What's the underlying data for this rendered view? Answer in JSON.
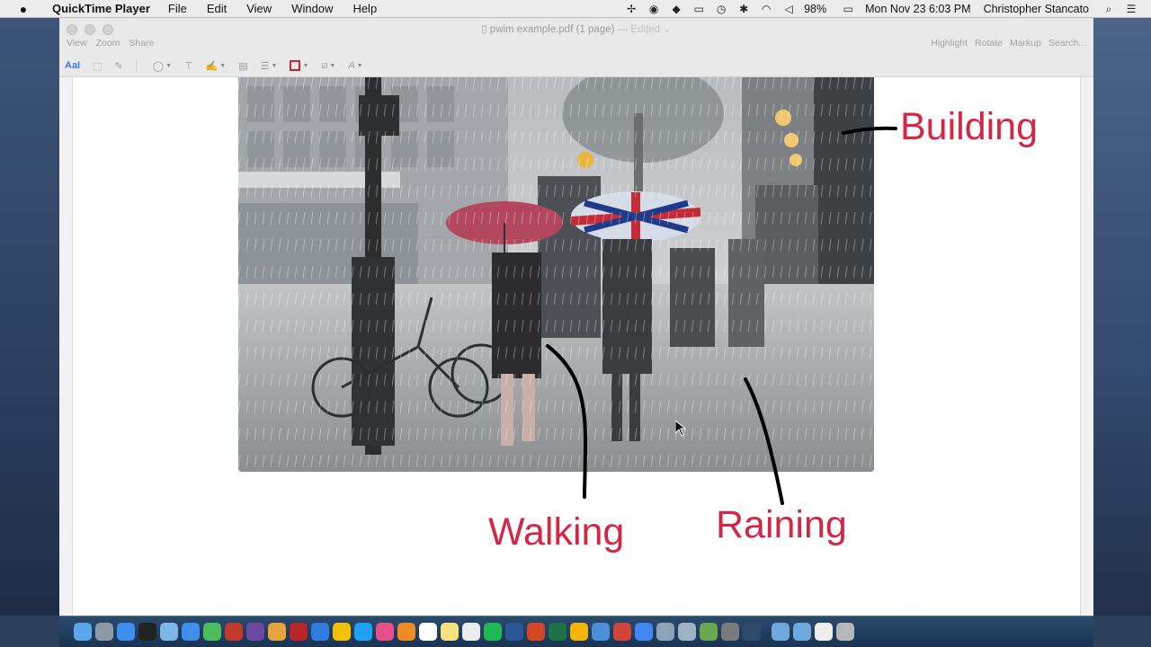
{
  "menubar": {
    "apple_glyph": "",
    "app_name": "QuickTime Player",
    "items": [
      "File",
      "Edit",
      "View",
      "Window",
      "Help"
    ],
    "battery": "98%",
    "datetime": "Mon Nov 23  6:03 PM",
    "user": "Christopher Stancato"
  },
  "window": {
    "title": "pwim example.pdf (1 page)",
    "edited": "— Edited",
    "left_tools": [
      "View",
      "Zoom",
      "Share"
    ],
    "right_tools": [
      "Highlight",
      "Rotate",
      "Markup",
      "Search..."
    ],
    "text_tool": "AaI"
  },
  "annotations": {
    "building": "Building",
    "walking": "Walking",
    "raining": "Raining"
  },
  "colors": {
    "annotation": "#d42745",
    "ink": "#000000"
  },
  "dock": {
    "icons": [
      "finder",
      "launchpad",
      "app-store",
      "dashboard",
      "preview",
      "safari",
      "messages",
      "photo-booth",
      "imovie",
      "photos",
      "acrobat",
      "dropbox",
      "drive",
      "twitter",
      "itunes",
      "ibooks",
      "calendar",
      "notes",
      "textedit",
      "spotify",
      "word",
      "powerpoint",
      "excel",
      "quickbooks",
      "pen",
      "mail",
      "chrome",
      "mail2",
      "mail3",
      "cleaner",
      "mac",
      "quicktime",
      "folder",
      "downloads",
      "doc",
      "trash"
    ]
  }
}
